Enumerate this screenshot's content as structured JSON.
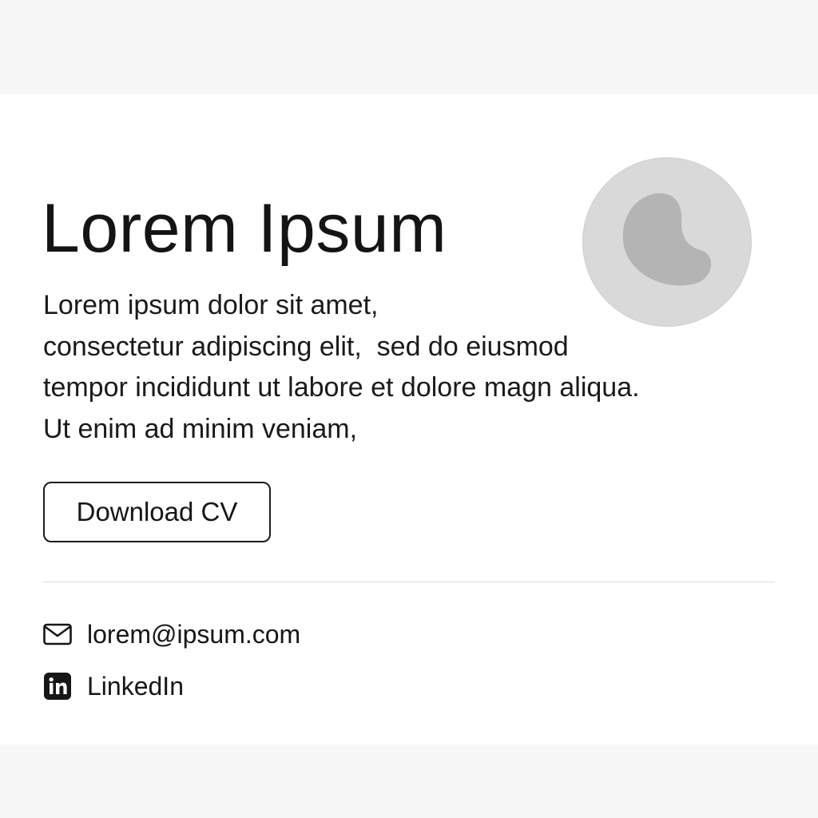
{
  "profile": {
    "name": "Lorem Ipsum",
    "bio_lines": [
      "Lorem ipsum dolor sit amet,",
      "consectetur adipiscing elit,  sed do eiusmod",
      "tempor incididunt ut labore et dolore magn aliqua.",
      "Ut enim ad minim veniam,"
    ],
    "avatar_icon": "avatar-placeholder-icon"
  },
  "actions": {
    "download_cv_label": "Download CV"
  },
  "contacts": {
    "email": {
      "icon": "mail-icon",
      "label": "lorem@ipsum.com"
    },
    "linkedin": {
      "icon": "linkedin-icon",
      "label": "LinkedIn"
    }
  },
  "colors": {
    "text": "#161616",
    "background": "#ffffff",
    "avatar_outer": "#d9d9d9",
    "avatar_inner": "#b4b4b4",
    "divider": "#dcdcdc"
  }
}
